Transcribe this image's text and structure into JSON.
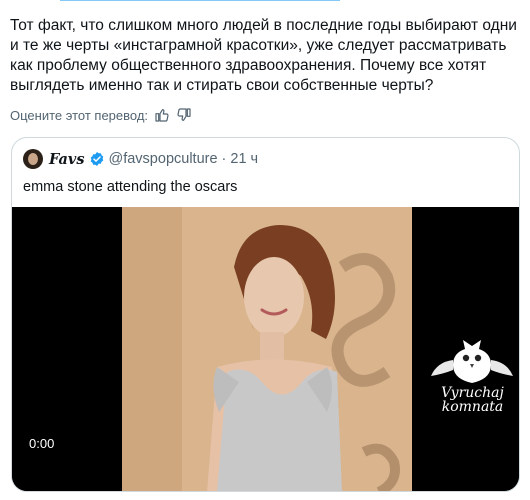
{
  "post": {
    "text": "Тот факт, что слишком много людей в последние годы выбирают одни и те же черты «инстаграмной красотки», уже следует рассматривать как проблему общественного здравоохранения. Почему все хотят выглядеть именно так и стирать свои собственные черты?",
    "rate_translation_label": "Оцените этот перевод:",
    "thumb_up_icon": "thumb-up-icon",
    "thumb_down_icon": "thumb-down-icon"
  },
  "quote": {
    "name": "Favs",
    "handle": "@favspopculture",
    "separator": "·",
    "time": "21 ч",
    "text": "emma stone attending the oscars",
    "verified_color": "#1d9bf0",
    "media": {
      "type": "video",
      "duration": "0:00",
      "watermark_line1": "Vyruchaj",
      "watermark_line2": "komnata"
    }
  }
}
